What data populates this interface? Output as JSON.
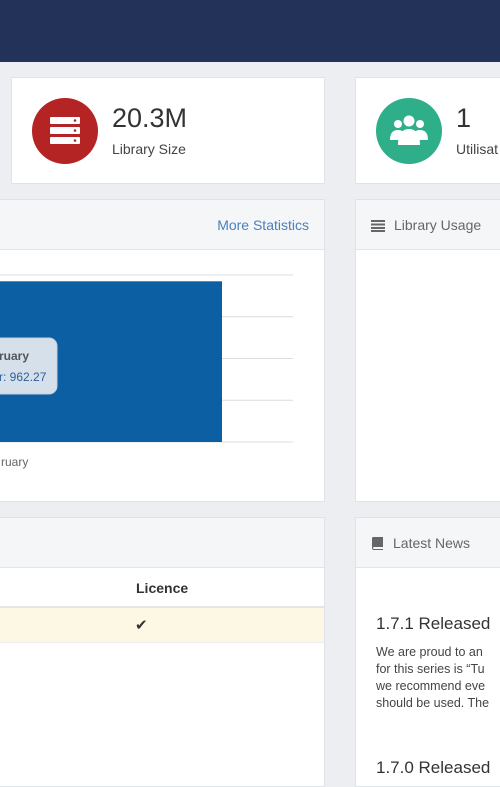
{
  "stats": [
    {
      "value": "20.3M",
      "label": "Library Size",
      "icon": "server-icon",
      "color": "#b42424"
    },
    {
      "value": "1",
      "label": "Utilisat",
      "icon": "users-icon",
      "color": "#2fae8a"
    }
  ],
  "chart_panel": {
    "link": "More Statistics"
  },
  "chart_data": {
    "type": "bar",
    "categories": [
      "ruary"
    ],
    "series": [
      {
        "values": [
          962.27
        ]
      }
    ],
    "tooltip": {
      "title": "ruary",
      "line": "r: 962.27"
    },
    "grid": true,
    "bar_color": "#0d5fa3"
  },
  "usage_panel": {
    "title": "Library Usage",
    "icon": "list-icon"
  },
  "table_panel": {
    "headers": [
      "Licence"
    ],
    "rows": [
      [
        "✔"
      ]
    ]
  },
  "news_panel": {
    "title": "Latest News",
    "icon": "book-icon",
    "items": [
      {
        "title": "1.7.1 Released",
        "lines": [
          "We are proud to an",
          "for this series is “Tu",
          "we recommend eve",
          "should be used. The"
        ]
      },
      {
        "title": "1.7.0 Released",
        "lines": []
      }
    ]
  }
}
